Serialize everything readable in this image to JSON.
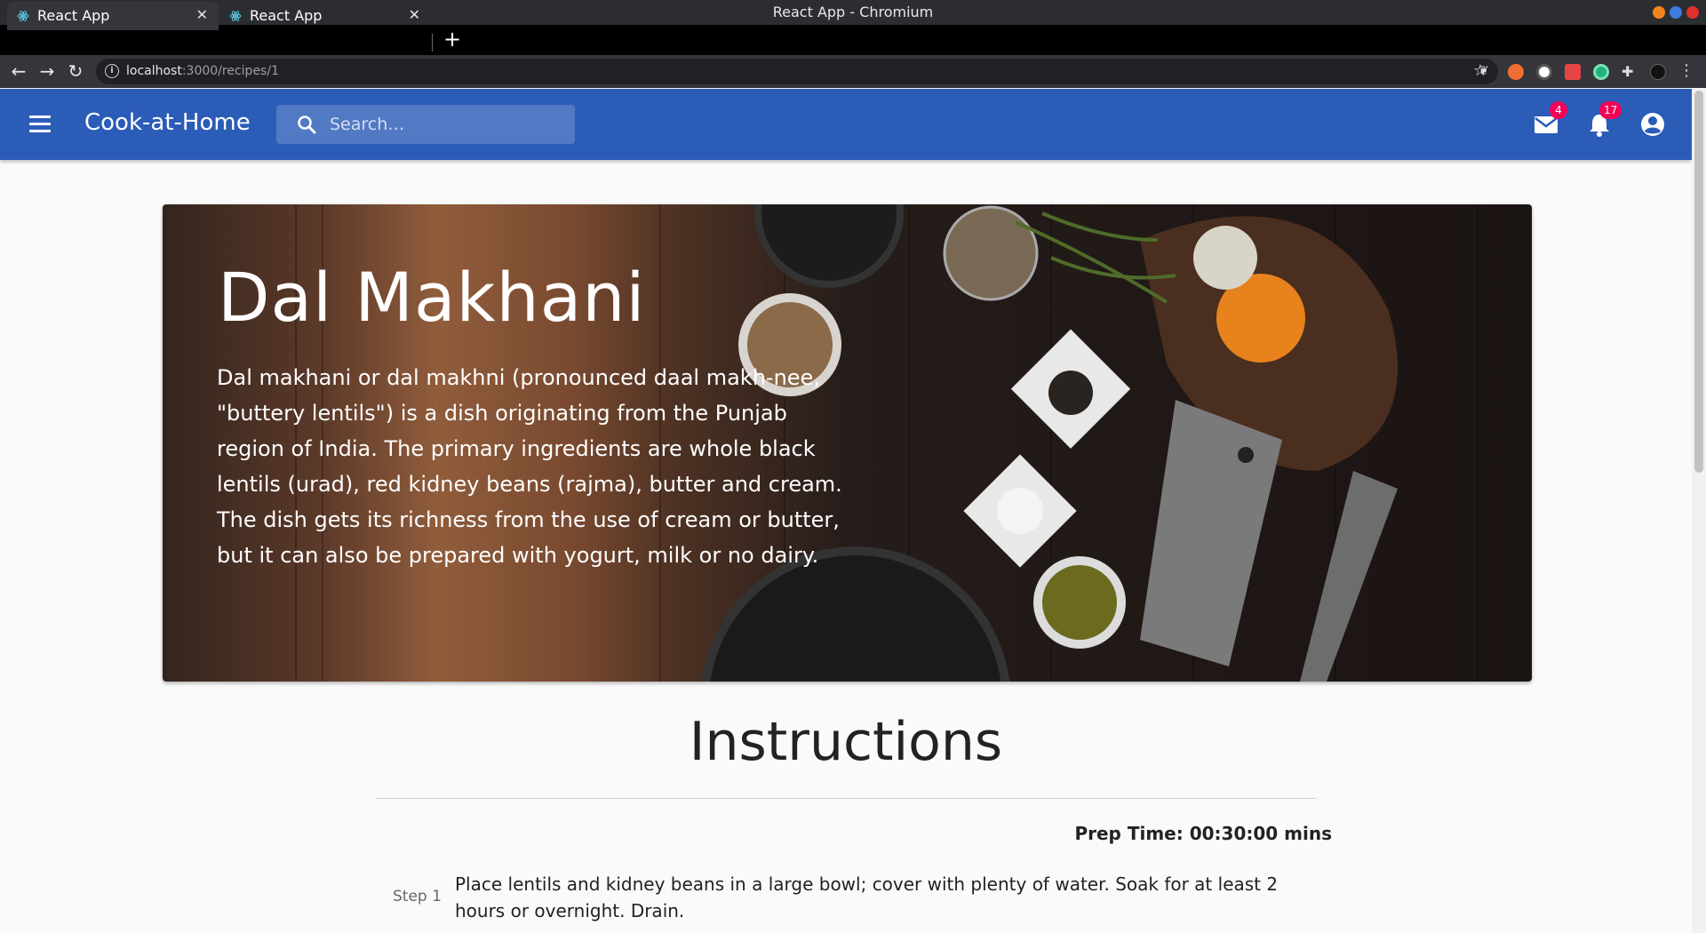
{
  "window": {
    "title": "React App - Chromium"
  },
  "tabs": [
    {
      "label": "React App"
    },
    {
      "label": "React App"
    }
  ],
  "address": {
    "host": "localhost",
    "path": ":3000/recipes/1"
  },
  "appbar": {
    "brand": "Cook-at-Home",
    "search_placeholder": "Search…",
    "mail_count": "4",
    "notification_count": "17",
    "color": "#2b5cb8"
  },
  "recipe": {
    "title": "Dal Makhani",
    "description": "Dal makhani or dal makhni (pronounced daal makh-nee, \"buttery lentils\") is a dish originating from the Punjab region of India. The primary ingredients are whole black lentils (urad), red kidney beans (rajma), butter and cream. The dish gets its richness from the use of cream or butter, but it can also be prepared with yogurt, milk or no dairy."
  },
  "instructions": {
    "heading": "Instructions",
    "prep_time": "Prep Time: 00:30:00 mins",
    "steps": [
      {
        "label": "Step 1",
        "text": "Place lentils and kidney beans in a large bowl; cover with plenty of water. Soak for at least 2 hours or overnight. Drain."
      }
    ]
  },
  "icons": [
    "react-favicon",
    "close-icon",
    "new-tab-icon",
    "back-icon",
    "forward-icon",
    "reload-icon",
    "info-icon",
    "bookmark-star-icon",
    "menu-icon",
    "search-icon",
    "mail-icon",
    "bell-icon",
    "account-circle-icon"
  ]
}
